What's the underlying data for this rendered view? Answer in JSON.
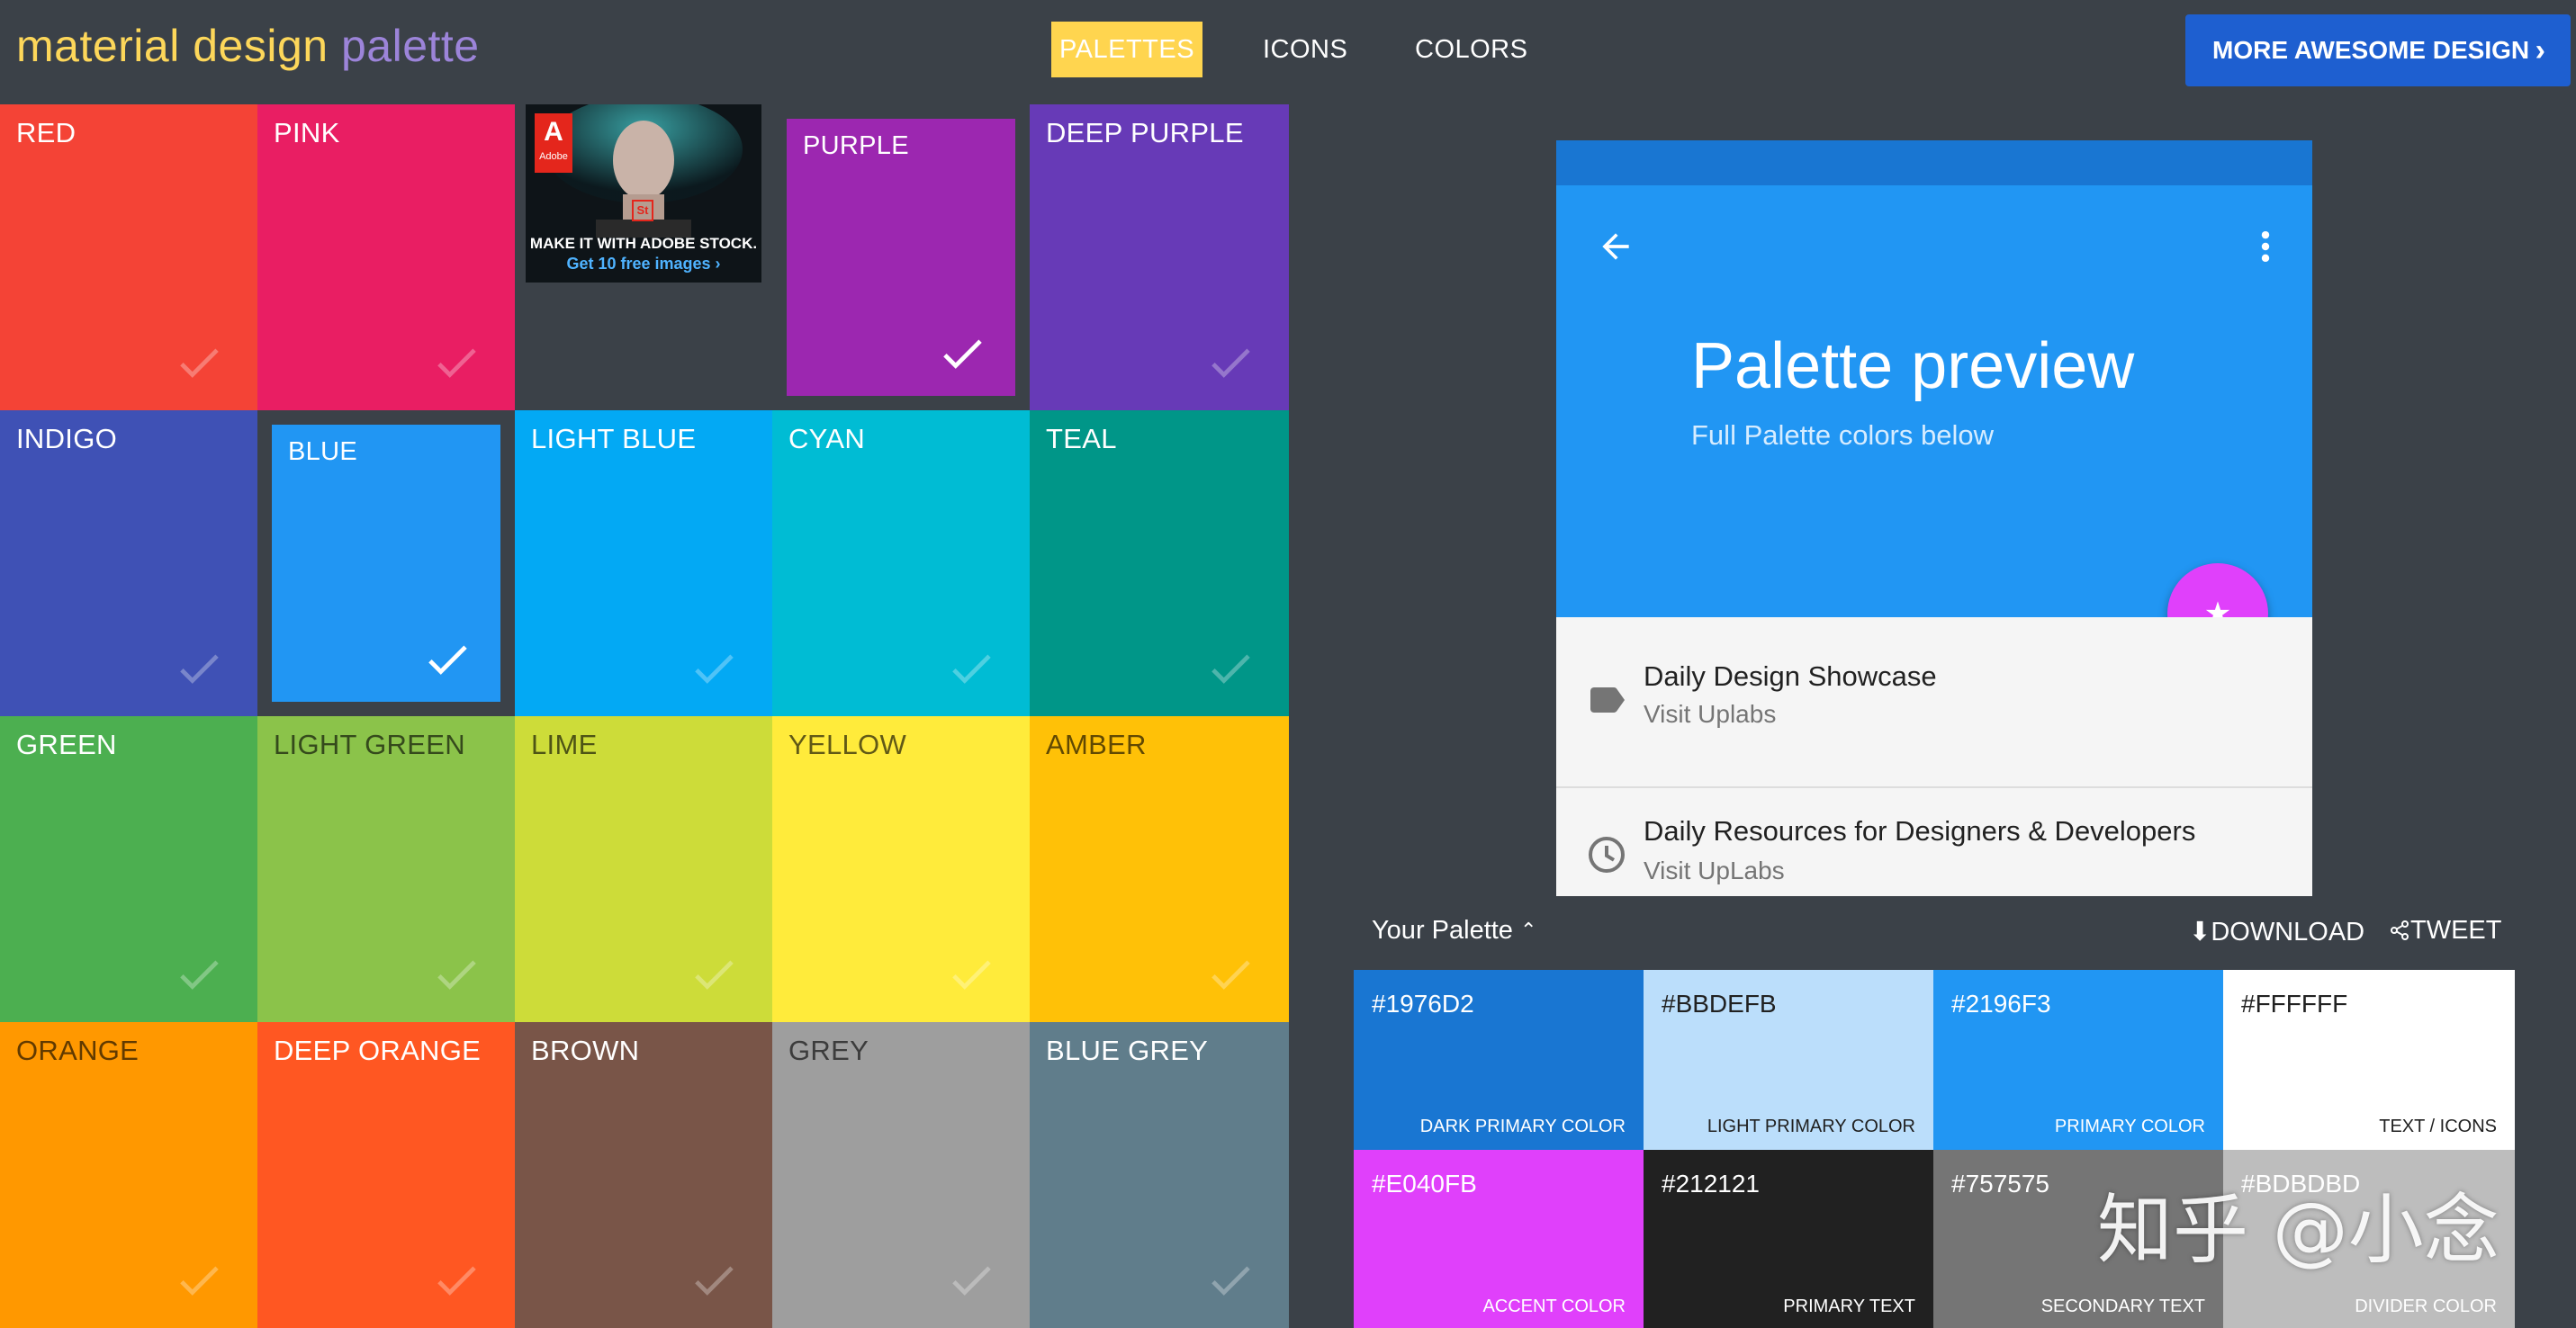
{
  "header": {
    "brand_part1": "material design",
    "brand_part2": "palette",
    "nav": [
      "PALETTES",
      "ICONS",
      "COLORS"
    ],
    "cta_label": "MORE AWESOME DESIGN",
    "brand_color_1": "#fdd75a",
    "brand_color_2": "#9c84d9",
    "accent_color": "#ffd54f",
    "cta_color": "#1e5fd0"
  },
  "ad": {
    "brand": "Adobe",
    "badge": "St",
    "line1": "MAKE IT WITH ADOBE STOCK.",
    "line2": "Get 10 free images ›"
  },
  "colors": [
    {
      "name": "RED",
      "hex": "#f44336",
      "text": "light",
      "selected": false
    },
    {
      "name": "PINK",
      "hex": "#e91e63",
      "text": "light",
      "selected": false
    },
    {
      "name": "PURPLE",
      "hex": "#9c27b0",
      "text": "light",
      "selected": true
    },
    {
      "name": "DEEP PURPLE",
      "hex": "#673ab7",
      "text": "light",
      "selected": false
    },
    {
      "name": "INDIGO",
      "hex": "#3f51b5",
      "text": "light",
      "selected": false
    },
    {
      "name": "BLUE",
      "hex": "#2196f3",
      "text": "light",
      "selected": true
    },
    {
      "name": "LIGHT BLUE",
      "hex": "#03a9f4",
      "text": "light",
      "selected": false
    },
    {
      "name": "CYAN",
      "hex": "#00bcd4",
      "text": "light",
      "selected": false
    },
    {
      "name": "TEAL",
      "hex": "#009688",
      "text": "light",
      "selected": false
    },
    {
      "name": "GREEN",
      "hex": "#4caf50",
      "text": "light",
      "selected": false
    },
    {
      "name": "LIGHT GREEN",
      "hex": "#8bc34a",
      "text": "dark",
      "selected": false
    },
    {
      "name": "LIME",
      "hex": "#cddc39",
      "text": "dark",
      "selected": false
    },
    {
      "name": "YELLOW",
      "hex": "#ffeb3b",
      "text": "dark",
      "selected": false
    },
    {
      "name": "AMBER",
      "hex": "#ffc107",
      "text": "dark",
      "selected": false
    },
    {
      "name": "ORANGE",
      "hex": "#ff9800",
      "text": "dark",
      "selected": false
    },
    {
      "name": "DEEP ORANGE",
      "hex": "#ff5722",
      "text": "light",
      "selected": false
    },
    {
      "name": "BROWN",
      "hex": "#795548",
      "text": "light",
      "selected": false
    },
    {
      "name": "GREY",
      "hex": "#9e9e9e",
      "text": "dark",
      "selected": false
    },
    {
      "name": "BLUE GREY",
      "hex": "#607d8b",
      "text": "light",
      "selected": false
    }
  ],
  "preview": {
    "title": "Palette preview",
    "subtitle": "Full Palette colors below",
    "items": [
      {
        "title": "Daily Design Showcase",
        "subtitle": "Visit Uplabs",
        "icon": "label-icon"
      },
      {
        "title": "Daily Resources for Designers & Developers",
        "subtitle": "Visit UpLabs",
        "icon": "clock-icon"
      }
    ]
  },
  "palette": {
    "title": "Your Palette",
    "download_label": "DOWNLOAD",
    "tweet_label": "TWEET",
    "swatches": [
      {
        "hex": "#1976D2",
        "role": "DARK PRIMARY COLOR",
        "text": "light"
      },
      {
        "hex": "#BBDEFB",
        "role": "LIGHT PRIMARY COLOR",
        "text": "dark"
      },
      {
        "hex": "#2196F3",
        "role": "PRIMARY COLOR",
        "text": "light"
      },
      {
        "hex": "#FFFFFF",
        "role": "TEXT / ICONS",
        "text": "dark"
      },
      {
        "hex": "#E040FB",
        "role": "ACCENT COLOR",
        "text": "light"
      },
      {
        "hex": "#212121",
        "role": "PRIMARY TEXT",
        "text": "light"
      },
      {
        "hex": "#757575",
        "role": "SECONDARY TEXT",
        "text": "light"
      },
      {
        "hex": "#BDBDBD",
        "role": "DIVIDER COLOR",
        "text": "light"
      }
    ]
  },
  "watermark": "知乎 @小念"
}
